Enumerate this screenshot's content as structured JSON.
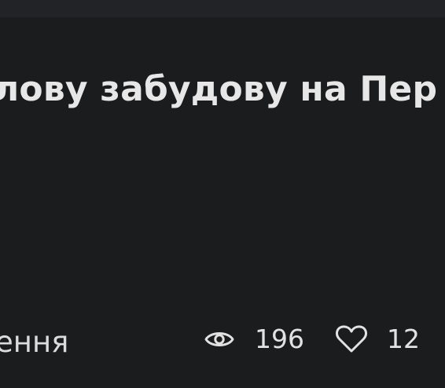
{
  "article": {
    "title": "лову забудову на Пер",
    "category": "ення",
    "stats": {
      "views": "196",
      "likes": "12"
    }
  },
  "icons": {
    "views": "eye-icon",
    "likes": "heart-icon"
  },
  "colors": {
    "background": "#1b1c1d",
    "top_strip": "#212326",
    "text": "#e7e7e7"
  }
}
